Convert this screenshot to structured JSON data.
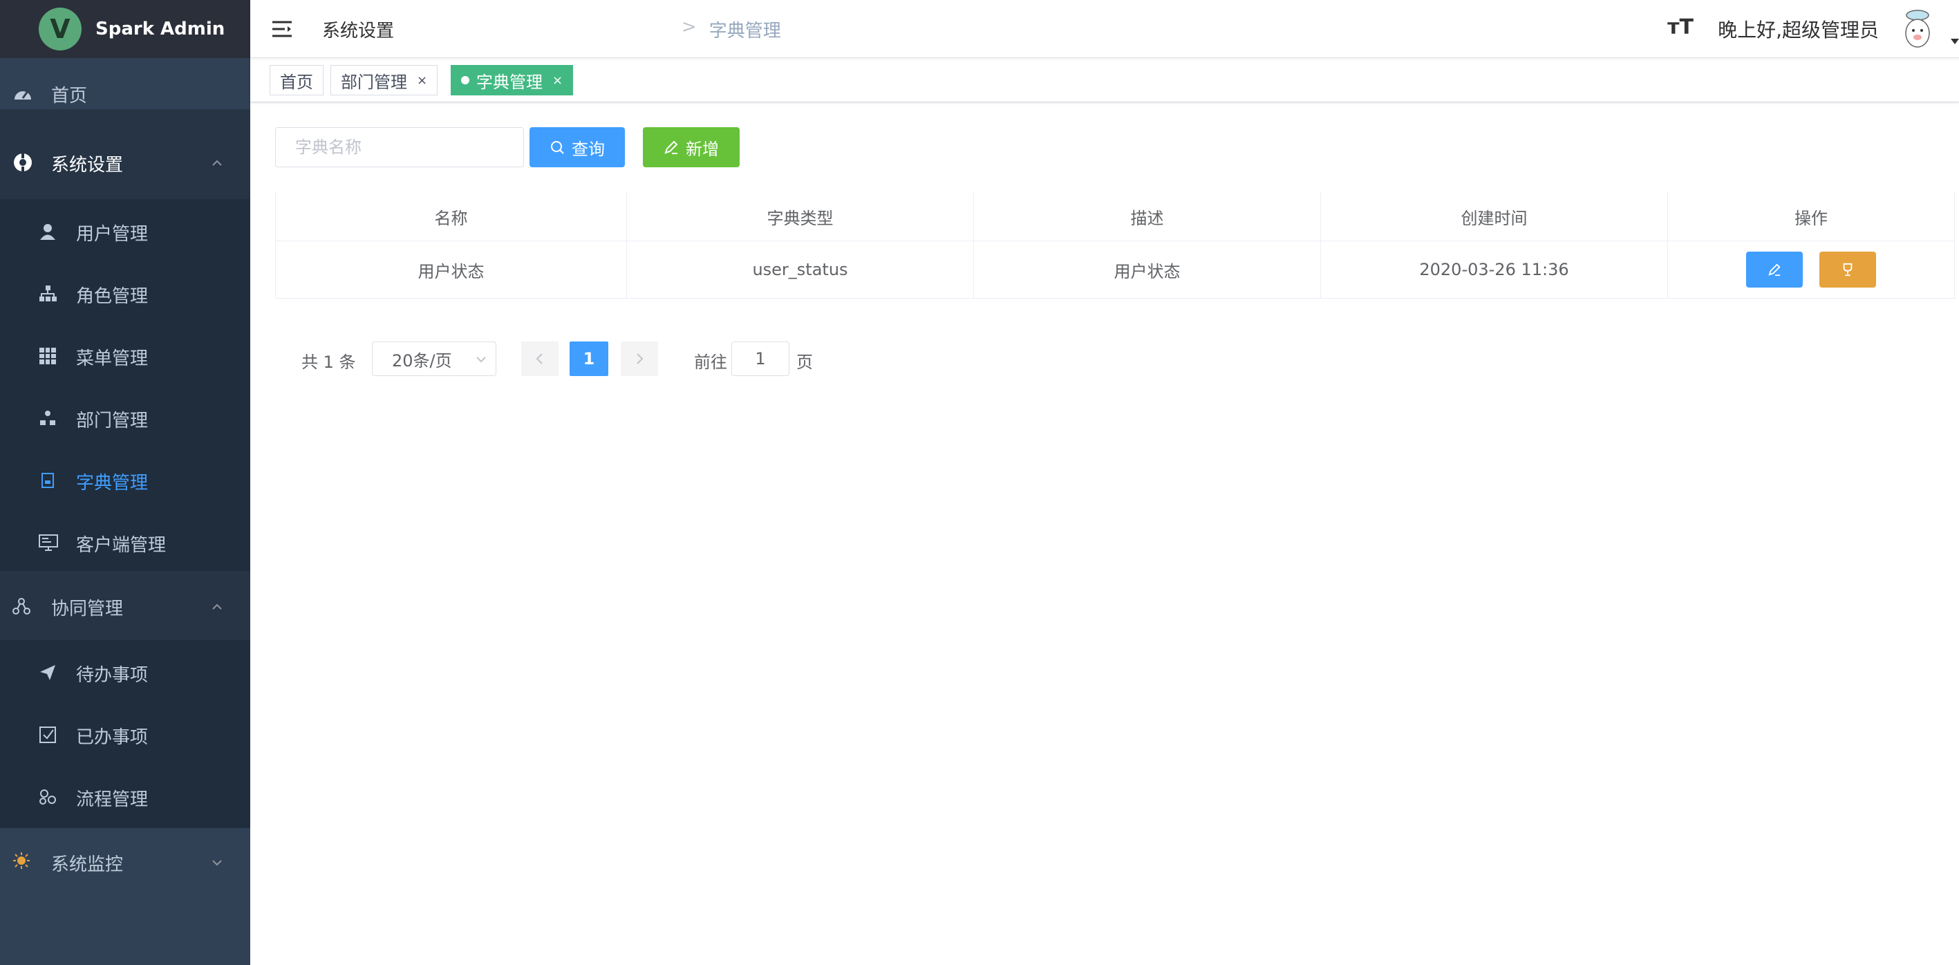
{
  "app": {
    "logo_letter": "V",
    "title": "Spark Admin"
  },
  "sidebar": {
    "items": [
      {
        "label": "首页",
        "icon": "dashboard-icon"
      },
      {
        "label": "系统设置",
        "icon": "settings-icon"
      },
      {
        "label": "用户管理",
        "icon": "user-icon"
      },
      {
        "label": "角色管理",
        "icon": "role-tree-icon"
      },
      {
        "label": "菜单管理",
        "icon": "grid-icon"
      },
      {
        "label": "部门管理",
        "icon": "org-icon"
      },
      {
        "label": "字典管理",
        "icon": "dictionary-icon",
        "active": true
      },
      {
        "label": "客户端管理",
        "icon": "monitor-icon"
      },
      {
        "label": "协同管理",
        "icon": "network-icon"
      },
      {
        "label": "待办事项",
        "icon": "paper-plane-icon"
      },
      {
        "label": "已办事项",
        "icon": "checkbox-icon"
      },
      {
        "label": "流程管理",
        "icon": "flow-icon"
      },
      {
        "label": "系统监控",
        "icon": "monitor-sun-icon"
      }
    ]
  },
  "header": {
    "breadcrumb": [
      "系统设置",
      "字典管理"
    ],
    "breadcrumb_sep": ">",
    "font_size_glyph": "тT",
    "greeting": "晚上好,超级管理员"
  },
  "tags": [
    {
      "label": "首页"
    },
    {
      "label": "部门管理",
      "close": "×"
    },
    {
      "label": "字典管理",
      "close": "×",
      "active": true
    }
  ],
  "toolbar": {
    "search_placeholder": "字典名称",
    "query_label": "查询",
    "add_label": "新增"
  },
  "table": {
    "columns": [
      "名称",
      "字典类型",
      "描述",
      "创建时间",
      "操作"
    ],
    "rows": [
      [
        "用户状态",
        "user_status",
        "用户状态",
        "2020-03-26 11:36"
      ]
    ]
  },
  "pagination": {
    "total": "共 1 条",
    "page_size": "20条/页",
    "current": "1",
    "goto_label": "前往",
    "goto_value": "1",
    "page_suffix": "页"
  },
  "colors": {
    "sidebar": "#304156",
    "primary": "#409eff",
    "success": "#67c23a",
    "warning": "#e6a23c",
    "tag": "#42b983"
  }
}
